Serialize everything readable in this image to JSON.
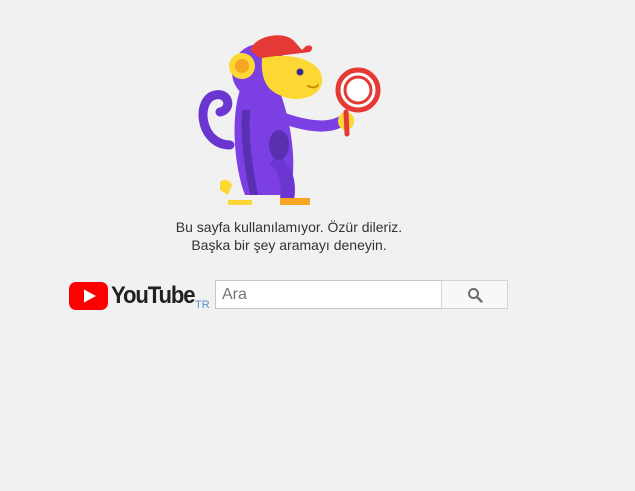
{
  "message": {
    "line1": "Bu sayfa kullanılamıyor. Özür dileriz.",
    "line2": "Başka bir şey aramayı deneyin."
  },
  "logo": {
    "wordmark": "YouTube",
    "country_code": "TR"
  },
  "search": {
    "placeholder": "Ara",
    "value": ""
  },
  "icons": {
    "illustration": "monkey-with-magnifier-illustration",
    "logo": "youtube-play-icon",
    "search": "search-icon"
  },
  "colors": {
    "background": "#f1f1f1",
    "logo_red": "#ff0000",
    "country_code": "#5a8fc8",
    "monkey_purple": "#7b3fe4",
    "cap_red": "#e53935",
    "face_yellow": "#fdd835"
  }
}
